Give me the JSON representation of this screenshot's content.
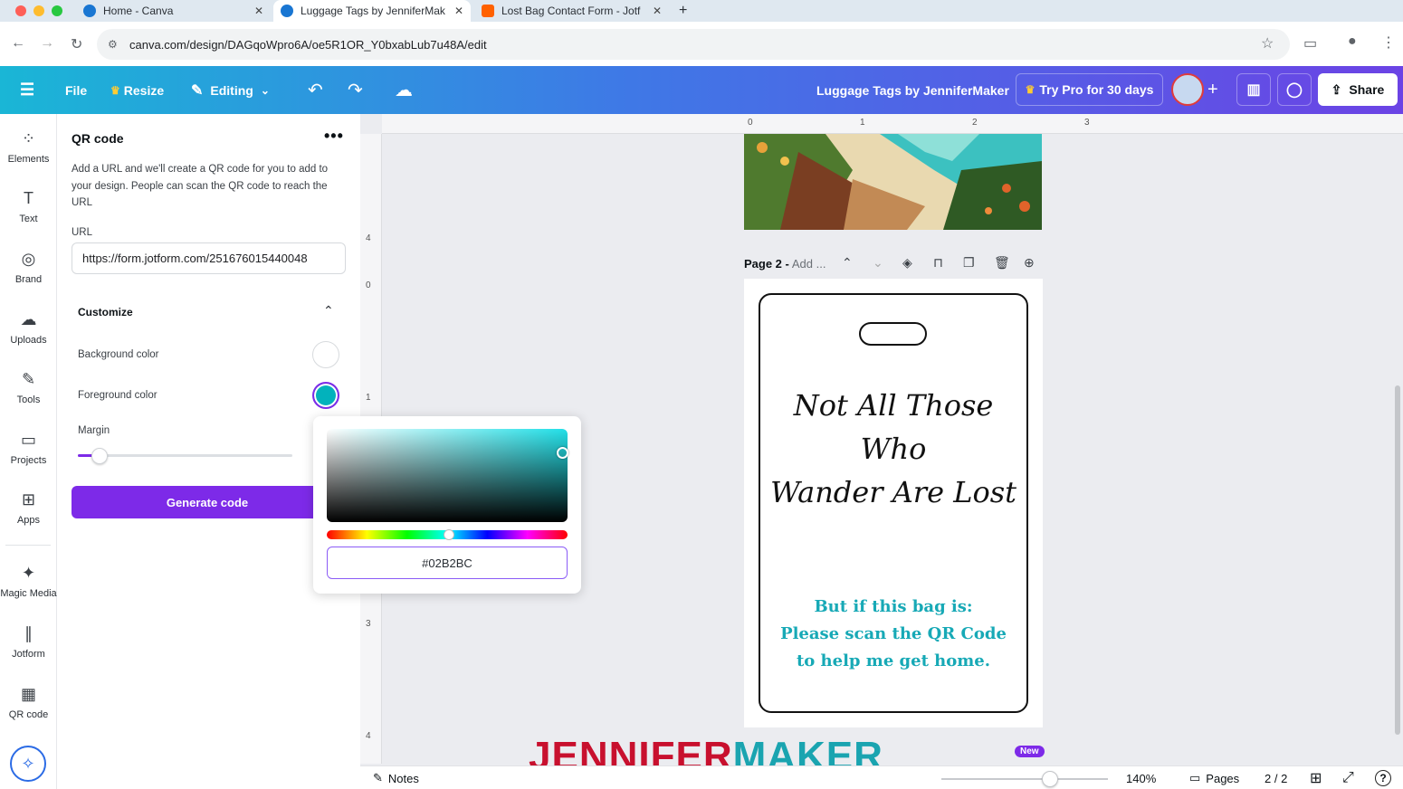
{
  "browser": {
    "tabs": [
      {
        "title": "Home - Canva",
        "active": false
      },
      {
        "title": "Luggage Tags by JenniferMak",
        "active": true
      },
      {
        "title": "Lost Bag Contact Form - Jotf",
        "active": false
      }
    ],
    "new_tab": "+",
    "address": "canva.com/design/DAGqoWpro6A/oe5R1OR_Y0bxabLub7u48A/edit"
  },
  "toolbar": {
    "file": "File",
    "resize": "Resize",
    "editing": "Editing",
    "doc_title": "Luggage Tags by JenniferMaker",
    "try_pro": "Try Pro for 30 days",
    "share": "Share"
  },
  "rail": {
    "items": [
      {
        "label": "Elements",
        "icon": "elements-icon"
      },
      {
        "label": "Text",
        "icon": "text-icon"
      },
      {
        "label": "Brand",
        "icon": "brand-icon"
      },
      {
        "label": "Uploads",
        "icon": "uploads-icon"
      },
      {
        "label": "Tools",
        "icon": "tools-icon"
      },
      {
        "label": "Projects",
        "icon": "projects-icon"
      },
      {
        "label": "Apps",
        "icon": "apps-icon"
      },
      {
        "label": "Magic Media",
        "icon": "magic-media-icon"
      },
      {
        "label": "Jotform",
        "icon": "jotform-icon"
      },
      {
        "label": "QR code",
        "icon": "qr-code-icon"
      }
    ]
  },
  "panel": {
    "title": "QR code",
    "description": "Add a URL and we'll create a QR code for you to add to your design. People can scan the QR code to reach the URL",
    "url_label": "URL",
    "url_value": "https://form.jotform.com/251676015440048",
    "customize": "Customize",
    "background_color_label": "Background color",
    "foreground_color_label": "Foreground color",
    "margin_label": "Margin",
    "margin_value": 0.1,
    "generate": "Generate code",
    "background_color": "#ffffff",
    "foreground_color": "#02B2BC"
  },
  "picker": {
    "hex": "#02B2BC",
    "hue_position": 0.5
  },
  "canvas": {
    "hruler_ticks": [
      "0",
      "1",
      "2",
      "3"
    ],
    "vruler_ticks": [
      "4",
      "0",
      "1",
      "3",
      "4"
    ],
    "page_label": "Page 2 - ",
    "page_label_add": "Add ...",
    "tag_script_line1": "Not All Those Who",
    "tag_script_line2": "Wander Are Lost",
    "tag_teal_line1": "But if this bag is:",
    "tag_teal_line2": "Please scan the QR Code",
    "tag_teal_line3": "to help me get home.",
    "teal_color": "#17a9b6"
  },
  "bottombar": {
    "notes": "Notes",
    "zoom": "140%",
    "pages": "Pages",
    "page_count": "2 / 2",
    "new_badge": "New",
    "help": "?"
  },
  "watermark": {
    "part1": "JENNIFER",
    "part2": "MAKER"
  }
}
